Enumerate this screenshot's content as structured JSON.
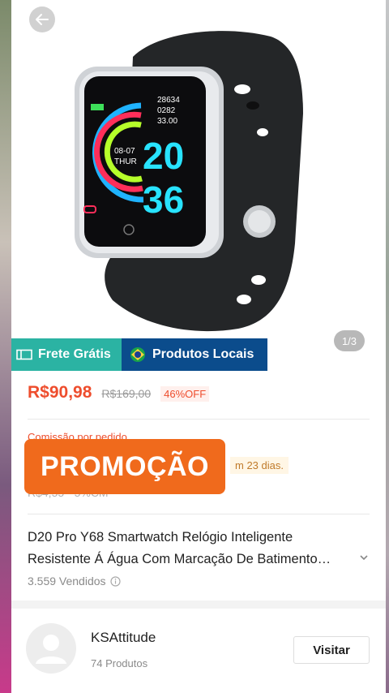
{
  "image": {
    "counter": "1/3",
    "watch_screen": {
      "steps": "28634",
      "heart": "0282",
      "dist": "33.00",
      "date": "08-07",
      "day": "THUR",
      "hour": "20",
      "minute": "36"
    }
  },
  "tags": {
    "free_shipping": "Frete Grátis",
    "local_products": "Produtos Locais"
  },
  "price": {
    "current": "R$90,98",
    "original": "R$169,00",
    "discount": "46%OFF"
  },
  "commission": {
    "label": "Comissão por pedido",
    "note": "m 23 dias.",
    "value": "R$4,55 · 5%CM"
  },
  "promo_banner": "PROMOÇÃO",
  "product": {
    "title_line1": "D20 Pro Y68 Smartwatch Relógio Inteligente",
    "title_line2": "Resistente Á Água Com Marcação De Batimento…",
    "sold": "3.559 Vendidos"
  },
  "shop": {
    "name": "KSAttitude",
    "products": "74 Produtos",
    "visit_label": "Visitar"
  },
  "colors": {
    "accent": "#ee4d2d",
    "promo": "#f06a1c",
    "free_tag": "#2bb3a3",
    "local_tag": "#0b4c8c"
  },
  "icons": [
    "back-arrow-icon",
    "truck-icon",
    "brazil-flag-icon",
    "info-icon",
    "chevron-down-icon",
    "avatar-placeholder-icon"
  ]
}
